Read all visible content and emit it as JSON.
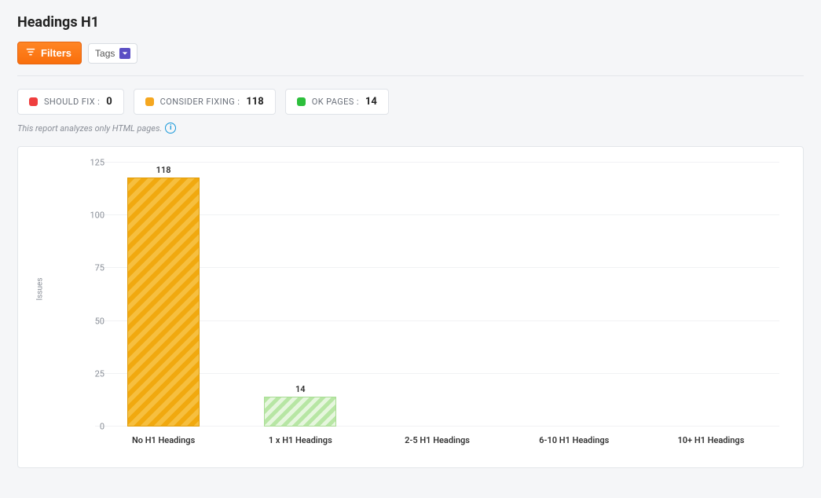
{
  "page": {
    "title": "Headings H1"
  },
  "toolbar": {
    "filters_label": "Filters",
    "tags_label": "Tags"
  },
  "stats": {
    "should_fix": {
      "label": "SHOULD FIX :",
      "value": "0"
    },
    "consider_fixing": {
      "label": "CONSIDER FIXING :",
      "value": "118"
    },
    "ok_pages": {
      "label": "OK PAGES :",
      "value": "14"
    }
  },
  "note": "This report analyzes only HTML pages.",
  "chart_data": {
    "type": "bar",
    "ylabel": "Issues",
    "ylim": [
      0,
      125
    ],
    "yticks": [
      0,
      25,
      50,
      75,
      100,
      125
    ],
    "categories": [
      "No H1 Headings",
      "1 x H1 Headings",
      "2-5 H1 Headings",
      "6-10 H1 Headings",
      "10+ H1 Headings"
    ],
    "values": [
      118,
      14,
      0,
      0,
      0
    ],
    "colors": [
      "orange",
      "green",
      "",
      "",
      ""
    ]
  }
}
